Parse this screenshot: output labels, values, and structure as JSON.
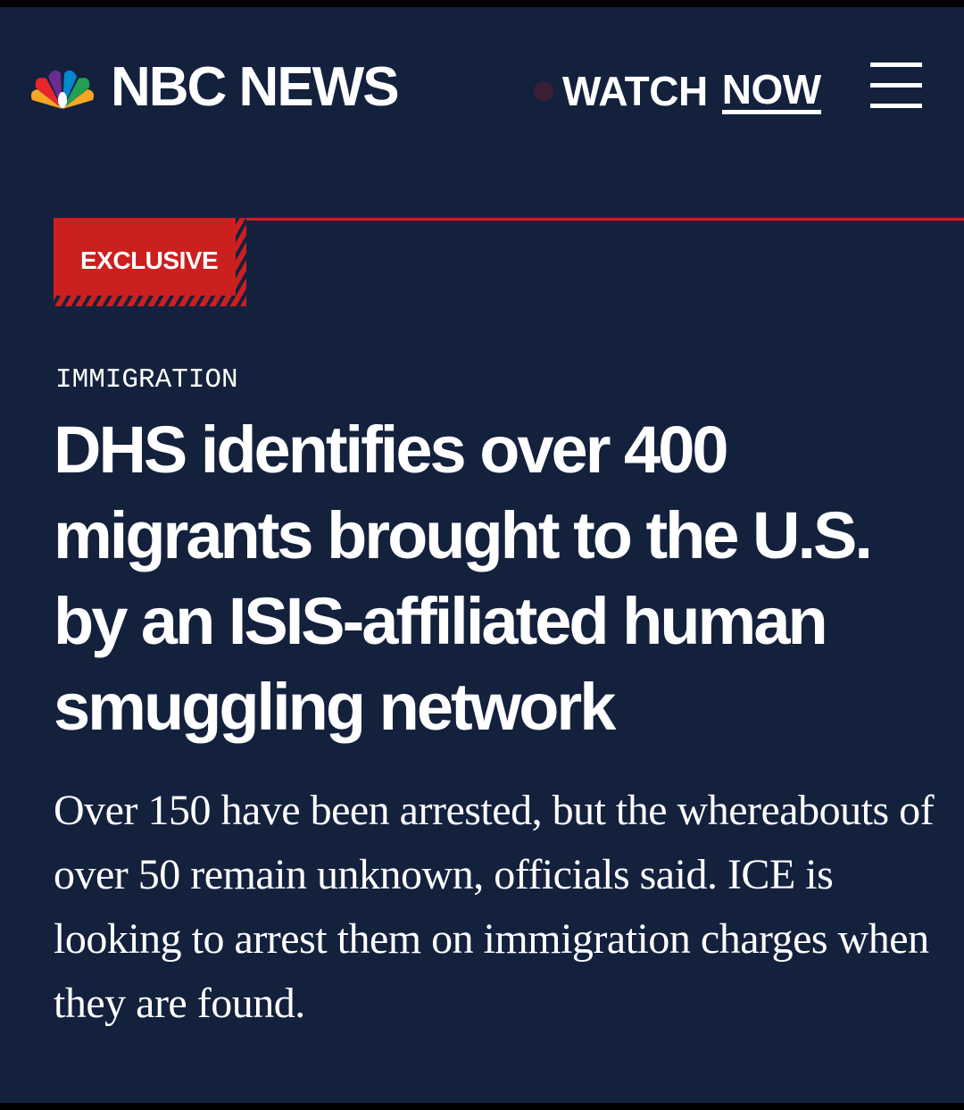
{
  "header": {
    "brand": "NBC NEWS",
    "watch_label": "WATCH",
    "now_label": "NOW"
  },
  "article": {
    "badge": "EXCLUSIVE",
    "category": "IMMIGRATION",
    "headline": "DHS identifies over 400 migrants brought to the U.S. by an ISIS-affiliated human smuggling network",
    "dek": "Over 150 have been arrested, but the whereabouts of over 50 remain unknown, officials said. ICE is looking to arrest them on immigration charges when they are found."
  },
  "icons": {
    "logo": "nbc-peacock-icon",
    "live": "live-dot-icon",
    "menu": "hamburger-menu-icon"
  },
  "colors": {
    "background": "#14213d",
    "accent_red": "#cc1f1f",
    "text": "#ffffff"
  }
}
